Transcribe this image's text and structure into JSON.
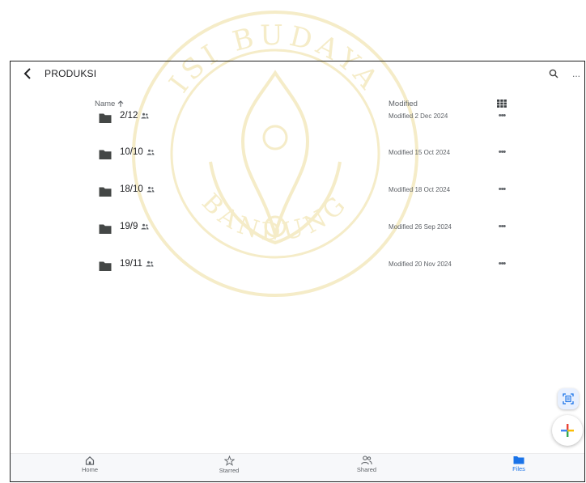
{
  "header": {
    "title": "PRODUKSI",
    "back_icon": "chevron-left-icon",
    "search_icon": "search-icon",
    "more_label": "..."
  },
  "columns": {
    "name": "Name",
    "name_sort_icon": "arrow-up-icon",
    "modified": "Modified",
    "view_icon": "grid-view-icon"
  },
  "files": [
    {
      "name": "2/12",
      "modified": "Modified 2 Dec 2024",
      "shared": true
    },
    {
      "name": "10/10",
      "modified": "Modified 15 Oct 2024",
      "shared": true
    },
    {
      "name": "18/10",
      "modified": "Modified 18 Oct 2024",
      "shared": true
    },
    {
      "name": "19/9",
      "modified": "Modified 26 Sep 2024",
      "shared": true
    },
    {
      "name": "19/11",
      "modified": "Modified 20 Nov 2024",
      "shared": true
    }
  ],
  "row_more_label": "•••",
  "fab": {
    "scan_icon": "document-scan-icon",
    "add_icon": "plus-icon"
  },
  "nav": [
    {
      "label": "Home",
      "icon": "home-icon",
      "active": false
    },
    {
      "label": "Starred",
      "icon": "star-icon",
      "active": false
    },
    {
      "label": "Shared",
      "icon": "people-icon",
      "active": false
    },
    {
      "label": "Files",
      "icon": "folder-icon",
      "active": true
    }
  ],
  "watermark": {
    "text_top": "ISI BUDAYA",
    "text_bottom": "BANDUNG",
    "color": "#f3e6b5"
  },
  "colors": {
    "accent": "#1a73e8",
    "folder": "#444746",
    "frame": "#1f1f1f"
  }
}
